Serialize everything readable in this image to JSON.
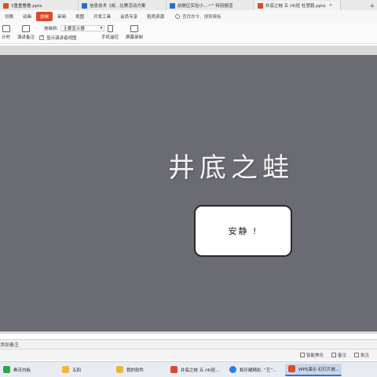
{
  "tabs": [
    {
      "label": "3重重叠叠.pptx",
      "color": "#d94b2b"
    },
    {
      "label": "信息技术《成...比赛活动方案",
      "color": "#2b6cd6"
    },
    {
      "label": "前陂区实验小...一” 特别报道",
      "color": "#2b6cd6"
    },
    {
      "label": "井底之蛙 五 (4)班 杜慧毅.pptx",
      "color": "#d94b2b",
      "active": true
    }
  ],
  "menu": {
    "items": [
      "切换",
      "动画",
      "放映",
      "审阅",
      "视图",
      "开发工具",
      "会员专享",
      "稻壳资源"
    ],
    "active_index": 2,
    "search": "查找命令、搜索模板"
  },
  "toolbar": {
    "item1": "计时",
    "item2": "演讲备注",
    "play_to_label": "放映到:",
    "play_to_value": "主要显示器",
    "show_presenter_view": "显示演讲者视图",
    "phone_remote": "手机遥控",
    "screen_record": "屏幕录制"
  },
  "slide": {
    "title": "井底之蛙",
    "card_text": "安静 !"
  },
  "notes": {
    "placeholder": "添加备注"
  },
  "status": {
    "smart_beautify": "智能美化",
    "notes_btn": "备注",
    "annotate_btn": "批注"
  },
  "taskbar": [
    {
      "label": "希沃白板",
      "color": "#2aa84a"
    },
    {
      "label": "五四",
      "color": "#e8b840"
    },
    {
      "label": "我的软件",
      "color": "#e8b840"
    },
    {
      "label": "井底之蛙 五 (4)班...",
      "color": "#d94b2b"
    },
    {
      "label": "和乐耀精彩, “艺”...",
      "color": "#2b7fd6"
    },
    {
      "label": "WPS演示 幻灯片放...",
      "color": "#d94b2b",
      "active": true
    }
  ]
}
